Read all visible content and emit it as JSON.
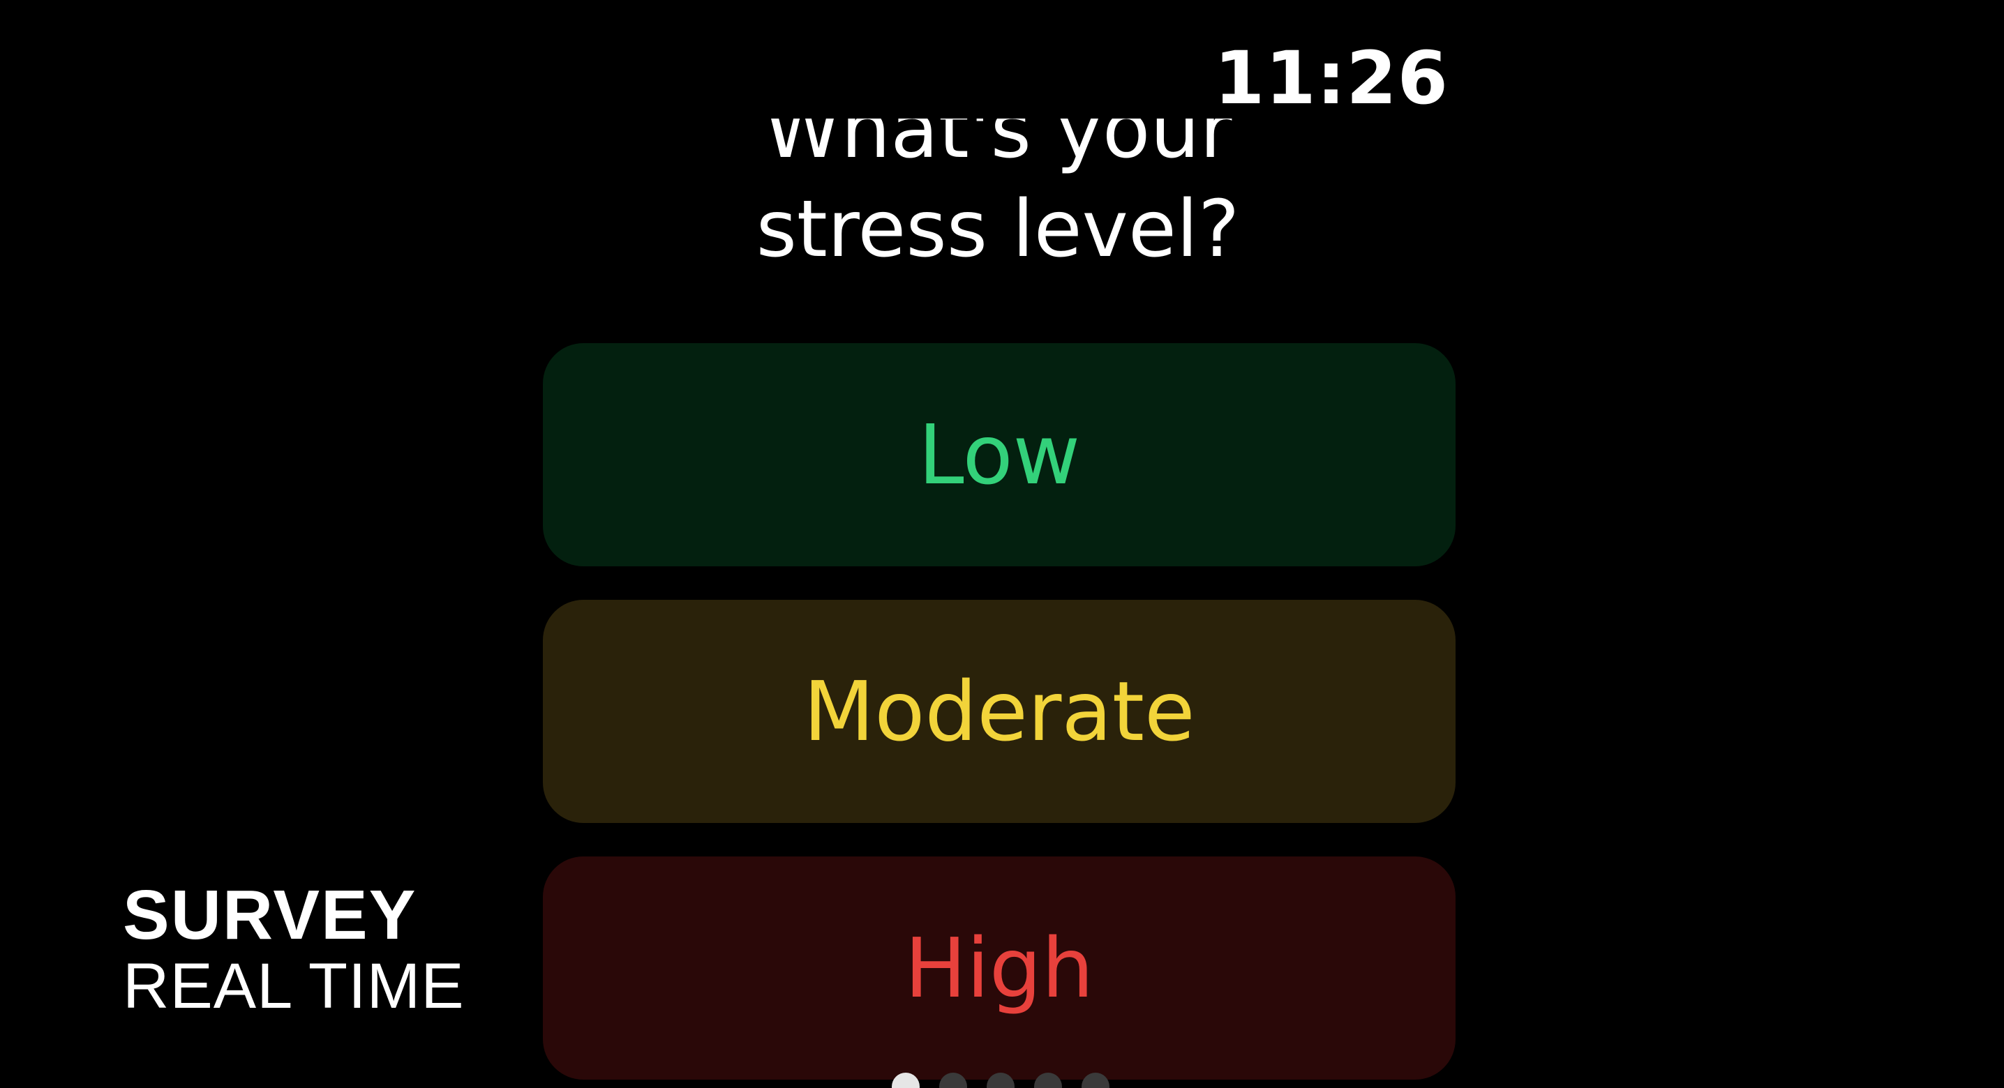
{
  "status_bar": {
    "time": "11:26"
  },
  "question": {
    "line1": "What's your",
    "line2": "stress level?"
  },
  "options": [
    {
      "label": "Low",
      "text_color": "#33d17a",
      "background": "#03200f"
    },
    {
      "label": "Moderate",
      "text_color": "#f2d43a",
      "background": "#2a220a"
    },
    {
      "label": "High",
      "text_color": "#e8413c",
      "background": "#2a0808"
    }
  ],
  "page_indicator": {
    "count": 5,
    "active_index": 0
  },
  "watermark": {
    "line1": "SURVEY",
    "line2": "REAL TIME"
  }
}
